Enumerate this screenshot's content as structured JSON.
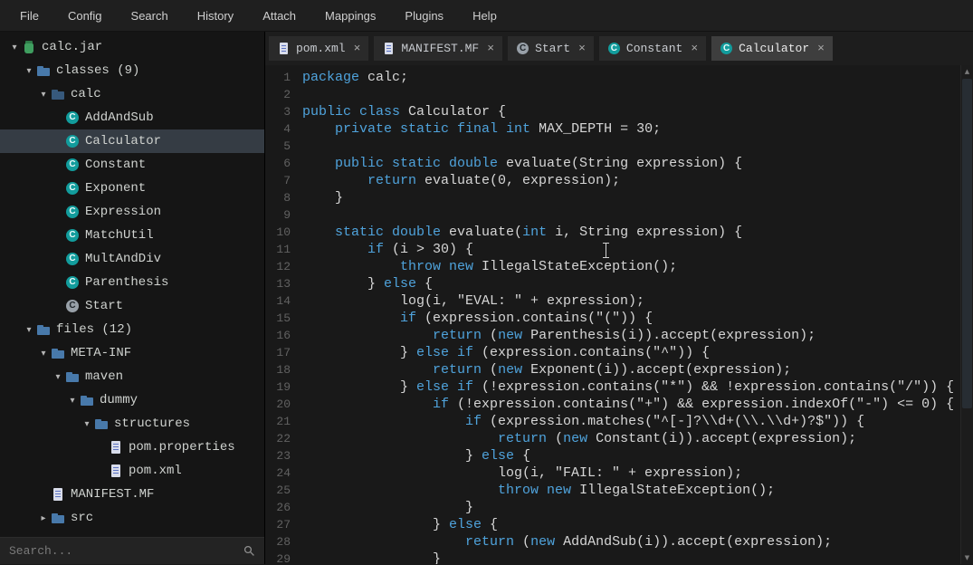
{
  "colors": {
    "keyword": "#4fa3dc",
    "plain_code": "#d6d6d6",
    "line_number": "#616161",
    "selection_bg": "#353c44",
    "class_icon": "#129c9c",
    "folder_icon": "#4879aa",
    "accent_tab_active": "#3e3e3e"
  },
  "menu": {
    "items": [
      {
        "label": "File"
      },
      {
        "label": "Config"
      },
      {
        "label": "Search"
      },
      {
        "label": "History"
      },
      {
        "label": "Attach"
      },
      {
        "label": "Mappings"
      },
      {
        "label": "Plugins"
      },
      {
        "label": "Help"
      }
    ]
  },
  "sidebar": {
    "tree": [
      {
        "label": "calc.jar",
        "depth": 0,
        "icon": "jar",
        "exp": "open"
      },
      {
        "label": "classes (9)",
        "depth": 1,
        "icon": "folder",
        "exp": "open"
      },
      {
        "label": "calc",
        "depth": 2,
        "icon": "package",
        "exp": "open"
      },
      {
        "label": "AddAndSub",
        "depth": 3,
        "icon": "class"
      },
      {
        "label": "Calculator",
        "depth": 3,
        "icon": "class",
        "selected": true
      },
      {
        "label": "Constant",
        "depth": 3,
        "icon": "class"
      },
      {
        "label": "Exponent",
        "depth": 3,
        "icon": "class"
      },
      {
        "label": "Expression",
        "depth": 3,
        "icon": "class"
      },
      {
        "label": "MatchUtil",
        "depth": 3,
        "icon": "class"
      },
      {
        "label": "MultAndDiv",
        "depth": 3,
        "icon": "class"
      },
      {
        "label": "Parenthesis",
        "depth": 3,
        "icon": "class"
      },
      {
        "label": "Start",
        "depth": 3,
        "icon": "class-gray"
      },
      {
        "label": "files (12)",
        "depth": 1,
        "icon": "folder",
        "exp": "open"
      },
      {
        "label": "META-INF",
        "depth": 2,
        "icon": "folder",
        "exp": "open"
      },
      {
        "label": "maven",
        "depth": 3,
        "icon": "folder",
        "exp": "open"
      },
      {
        "label": "dummy",
        "depth": 4,
        "icon": "folder",
        "exp": "open"
      },
      {
        "label": "structures",
        "depth": 5,
        "icon": "folder",
        "exp": "open"
      },
      {
        "label": "pom.properties",
        "depth": 6,
        "icon": "file"
      },
      {
        "label": "pom.xml",
        "depth": 6,
        "icon": "file"
      },
      {
        "label": "MANIFEST.MF",
        "depth": 2,
        "icon": "file"
      },
      {
        "label": "src",
        "depth": 2,
        "icon": "folder",
        "exp": "closed"
      }
    ],
    "search": {
      "placeholder": "Search..."
    }
  },
  "tabs": [
    {
      "label": "pom.xml",
      "icon": "file",
      "close": "×"
    },
    {
      "label": "MANIFEST.MF",
      "icon": "file",
      "close": "×"
    },
    {
      "label": "Start",
      "icon": "class-gray",
      "close": "×"
    },
    {
      "label": "Constant",
      "icon": "class",
      "close": "×"
    },
    {
      "label": "Calculator",
      "icon": "class",
      "close": "×",
      "active": true
    }
  ],
  "editor": {
    "lines": [
      {
        "n": 1,
        "seg": [
          [
            "k",
            "package"
          ],
          [
            "p",
            " calc;"
          ]
        ]
      },
      {
        "n": 2,
        "seg": []
      },
      {
        "n": 3,
        "seg": [
          [
            "k",
            "public class"
          ],
          [
            "p",
            " Calculator {"
          ]
        ]
      },
      {
        "n": 4,
        "seg": [
          [
            "p",
            "    "
          ],
          [
            "k",
            "private static final int"
          ],
          [
            "p",
            " MAX_DEPTH = 30;"
          ]
        ]
      },
      {
        "n": 5,
        "seg": []
      },
      {
        "n": 6,
        "seg": [
          [
            "p",
            "    "
          ],
          [
            "k",
            "public static double"
          ],
          [
            "p",
            " evaluate(String expression) {"
          ]
        ]
      },
      {
        "n": 7,
        "seg": [
          [
            "p",
            "        "
          ],
          [
            "k",
            "return"
          ],
          [
            "p",
            " evaluate(0, expression);"
          ]
        ]
      },
      {
        "n": 8,
        "seg": [
          [
            "p",
            "    }"
          ]
        ]
      },
      {
        "n": 9,
        "seg": []
      },
      {
        "n": 10,
        "seg": [
          [
            "p",
            "    "
          ],
          [
            "k",
            "static double"
          ],
          [
            "p",
            " evaluate("
          ],
          [
            "k",
            "int"
          ],
          [
            "p",
            " i, String expression) {"
          ]
        ]
      },
      {
        "n": 11,
        "seg": [
          [
            "p",
            "        "
          ],
          [
            "k",
            "if"
          ],
          [
            "p",
            " (i > 30) {"
          ]
        ]
      },
      {
        "n": 12,
        "seg": [
          [
            "p",
            "            "
          ],
          [
            "k",
            "throw new"
          ],
          [
            "p",
            " IllegalStateException();"
          ]
        ]
      },
      {
        "n": 13,
        "seg": [
          [
            "p",
            "        } "
          ],
          [
            "k",
            "else"
          ],
          [
            "p",
            " {"
          ]
        ]
      },
      {
        "n": 14,
        "seg": [
          [
            "p",
            "            log(i, \"EVAL: \" + expression);"
          ]
        ]
      },
      {
        "n": 15,
        "seg": [
          [
            "p",
            "            "
          ],
          [
            "k",
            "if"
          ],
          [
            "p",
            " (expression.contains(\"(\")) {"
          ]
        ]
      },
      {
        "n": 16,
        "seg": [
          [
            "p",
            "                "
          ],
          [
            "k",
            "return"
          ],
          [
            "p",
            " ("
          ],
          [
            "k",
            "new"
          ],
          [
            "p",
            " Parenthesis(i)).accept(expression);"
          ]
        ]
      },
      {
        "n": 17,
        "seg": [
          [
            "p",
            "            } "
          ],
          [
            "k",
            "else if"
          ],
          [
            "p",
            " (expression.contains(\"^\")) {"
          ]
        ]
      },
      {
        "n": 18,
        "seg": [
          [
            "p",
            "                "
          ],
          [
            "k",
            "return"
          ],
          [
            "p",
            " ("
          ],
          [
            "k",
            "new"
          ],
          [
            "p",
            " Exponent(i)).accept(expression);"
          ]
        ]
      },
      {
        "n": 19,
        "seg": [
          [
            "p",
            "            } "
          ],
          [
            "k",
            "else if"
          ],
          [
            "p",
            " (!expression.contains(\"*\") && !expression.contains(\"/\")) {"
          ]
        ]
      },
      {
        "n": 20,
        "seg": [
          [
            "p",
            "                "
          ],
          [
            "k",
            "if"
          ],
          [
            "p",
            " (!expression.contains(\"+\") && expression.indexOf(\"-\") <= 0) {"
          ]
        ]
      },
      {
        "n": 21,
        "seg": [
          [
            "p",
            "                    "
          ],
          [
            "k",
            "if"
          ],
          [
            "p",
            " (expression.matches(\"^[-]?\\\\d+(\\\\.\\\\d+)?$\")) {"
          ]
        ]
      },
      {
        "n": 22,
        "seg": [
          [
            "p",
            "                        "
          ],
          [
            "k",
            "return"
          ],
          [
            "p",
            " ("
          ],
          [
            "k",
            "new"
          ],
          [
            "p",
            " Constant(i)).accept(expression);"
          ]
        ]
      },
      {
        "n": 23,
        "seg": [
          [
            "p",
            "                    } "
          ],
          [
            "k",
            "else"
          ],
          [
            "p",
            " {"
          ]
        ]
      },
      {
        "n": 24,
        "seg": [
          [
            "p",
            "                        log(i, \"FAIL: \" + expression);"
          ]
        ]
      },
      {
        "n": 25,
        "seg": [
          [
            "p",
            "                        "
          ],
          [
            "k",
            "throw new"
          ],
          [
            "p",
            " IllegalStateException();"
          ]
        ]
      },
      {
        "n": 26,
        "seg": [
          [
            "p",
            "                    }"
          ]
        ]
      },
      {
        "n": 27,
        "seg": [
          [
            "p",
            "                } "
          ],
          [
            "k",
            "else"
          ],
          [
            "p",
            " {"
          ]
        ]
      },
      {
        "n": 28,
        "seg": [
          [
            "p",
            "                    "
          ],
          [
            "k",
            "return"
          ],
          [
            "p",
            " ("
          ],
          [
            "k",
            "new"
          ],
          [
            "p",
            " AddAndSub(i)).accept(expression);"
          ]
        ]
      },
      {
        "n": 29,
        "seg": [
          [
            "p",
            "                }"
          ]
        ]
      }
    ]
  }
}
